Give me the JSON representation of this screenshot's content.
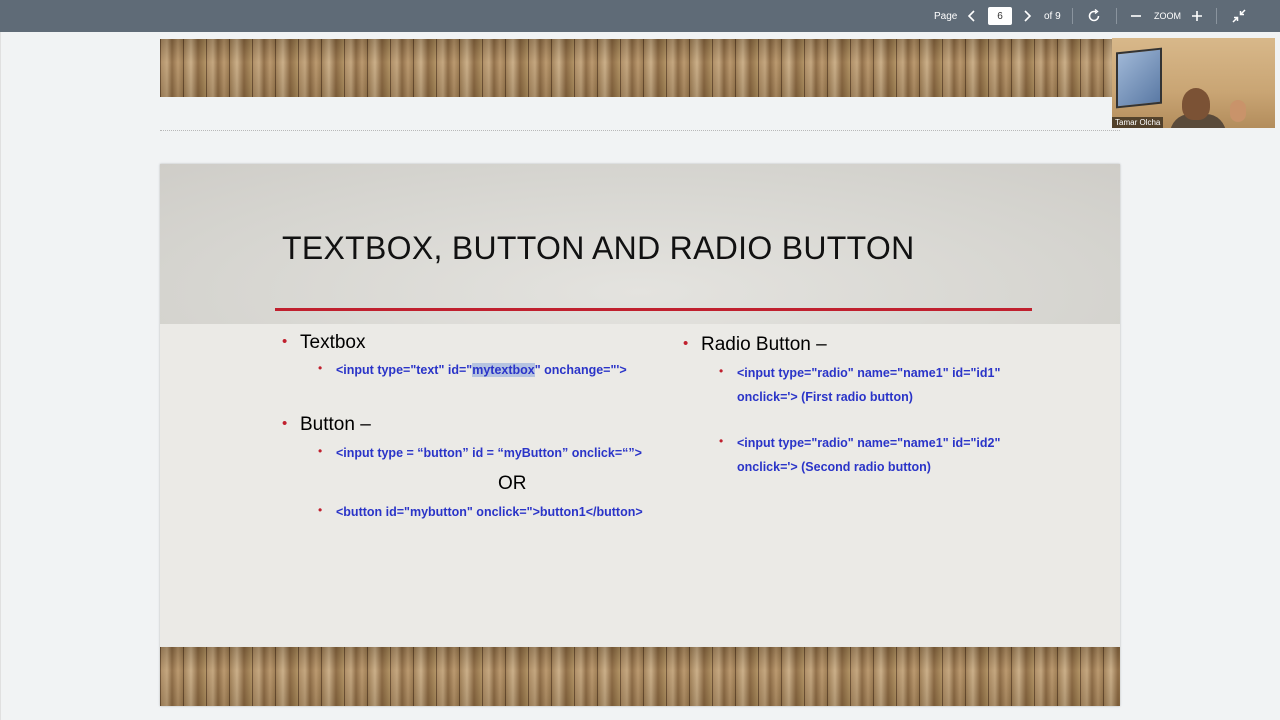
{
  "toolbar": {
    "page_label": "Page",
    "current_page": "6",
    "total_pages": "of 9",
    "zoom_label": "ZOOM"
  },
  "slide": {
    "title": "TEXTBOX, BUTTON AND RADIO BUTTON",
    "left_column": {
      "textbox_heading": "Textbox",
      "textbox_code_prefix": "<input type=\"text\" id=\"",
      "textbox_code_highlight": "mytextbox",
      "textbox_code_suffix": "\" onchange=\"'>",
      "button_heading": "Button –",
      "button_code_1": "<input type = “button” id = “myButton” onclick=“”>",
      "or_text": "OR",
      "button_code_2": "<button id=\"mybutton\" onclick=\">button1</button>"
    },
    "right_column": {
      "radio_heading": "Radio Button –",
      "radio_1_line1": "<input type=\"radio\" name=\"name1\" id=\"id1\"",
      "radio_1_line2": "onclick='> (First radio button)",
      "radio_2_line1": "<input type=\"radio\" name=\"name1\" id=\"id2\"",
      "radio_2_line2": "onclick='> (Second radio button)"
    }
  },
  "webcam": {
    "participant_name": "Tamar Olcha"
  },
  "colors": {
    "toolbar_bg": "#5f6b77",
    "title_rule": "#c0202e",
    "code_text": "#2a34c8",
    "bullet": "#c0202e"
  }
}
